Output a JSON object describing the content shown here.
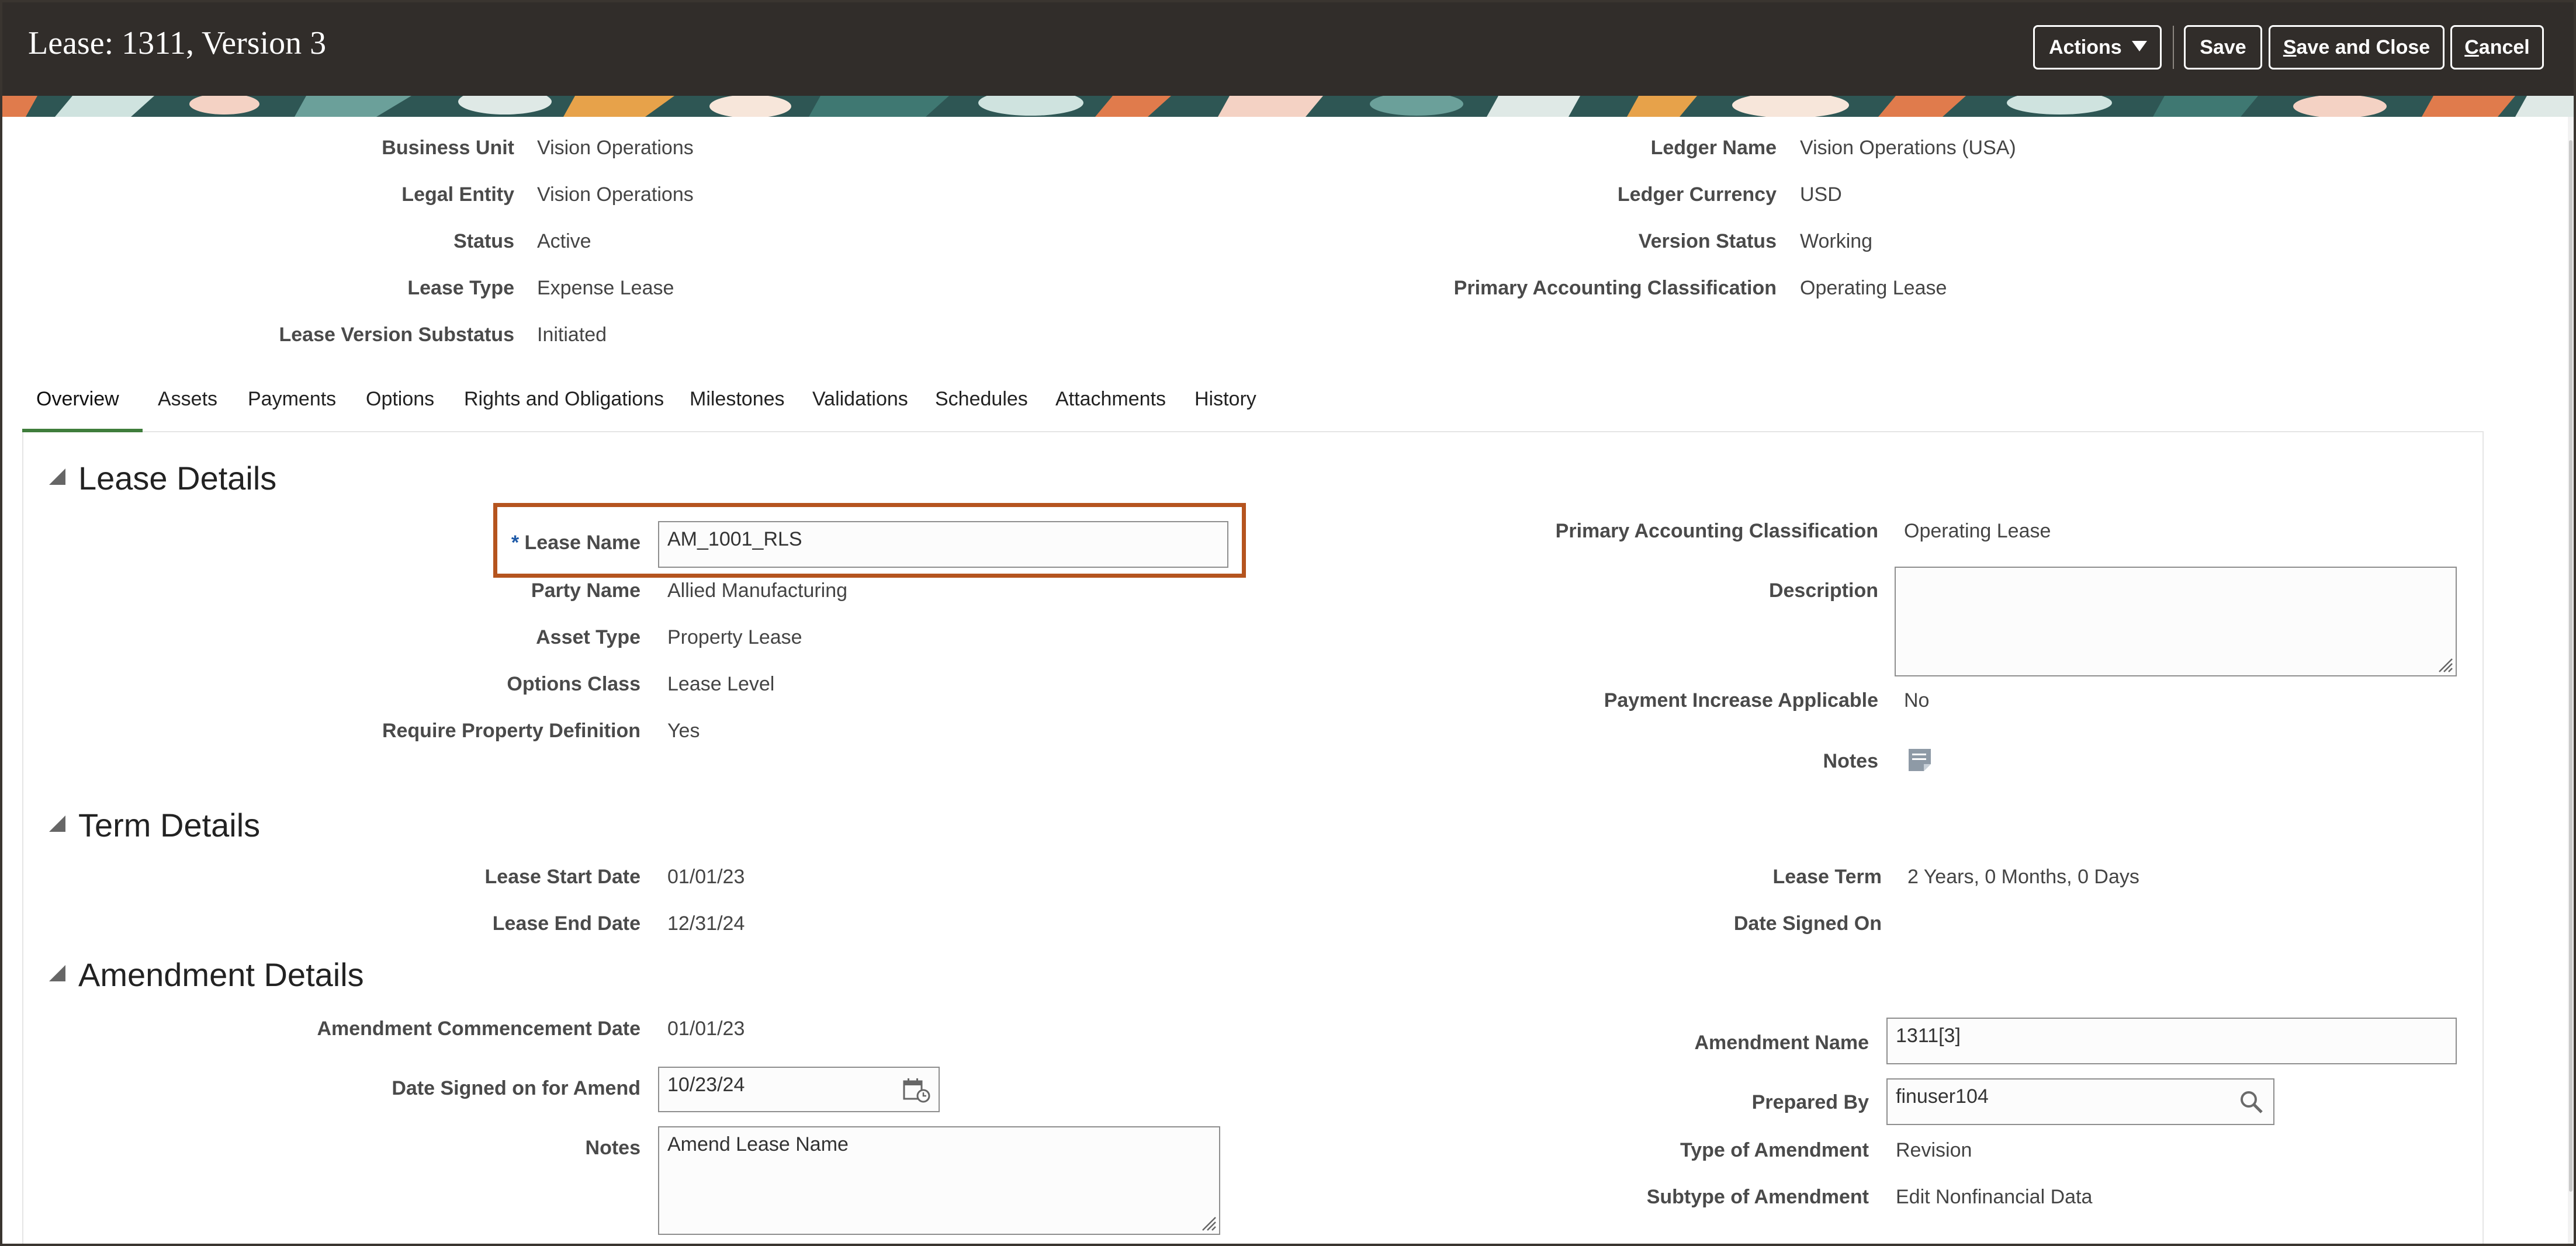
{
  "header": {
    "title": "Lease: 1311, Version 3",
    "actions_label": "Actions",
    "save_label": "Save",
    "save_close_label": "Save and Close",
    "cancel_label": "Cancel"
  },
  "summary": {
    "business_unit": {
      "label": "Business Unit",
      "value": "Vision Operations"
    },
    "legal_entity": {
      "label": "Legal Entity",
      "value": "Vision Operations"
    },
    "status": {
      "label": "Status",
      "value": "Active"
    },
    "lease_type": {
      "label": "Lease Type",
      "value": "Expense Lease"
    },
    "lease_version_substatus": {
      "label": "Lease Version Substatus",
      "value": "Initiated"
    },
    "ledger_name": {
      "label": "Ledger Name",
      "value": "Vision Operations (USA)"
    },
    "ledger_currency": {
      "label": "Ledger Currency",
      "value": "USD"
    },
    "version_status": {
      "label": "Version Status",
      "value": "Working"
    },
    "primary_accounting_classification": {
      "label": "Primary Accounting Classification",
      "value": "Operating Lease"
    }
  },
  "tabs": [
    "Overview",
    "Assets",
    "Payments",
    "Options",
    "Rights and Obligations",
    "Milestones",
    "Validations",
    "Schedules",
    "Attachments",
    "History"
  ],
  "active_tab": "Overview",
  "lease_details": {
    "title": "Lease Details",
    "required_mark": "*",
    "lease_name": {
      "label": "Lease Name",
      "value": "AM_1001_RLS"
    },
    "party_name": {
      "label": "Party Name",
      "value": "Allied Manufacturing"
    },
    "asset_type": {
      "label": "Asset Type",
      "value": "Property Lease"
    },
    "options_class": {
      "label": "Options Class",
      "value": "Lease Level"
    },
    "require_property_definition": {
      "label": "Require Property Definition",
      "value": "Yes"
    },
    "primary_accounting_classification": {
      "label": "Primary Accounting Classification",
      "value": "Operating Lease"
    },
    "description": {
      "label": "Description",
      "value": ""
    },
    "payment_increase_applicable": {
      "label": "Payment Increase Applicable",
      "value": "No"
    },
    "notes": {
      "label": "Notes"
    }
  },
  "term_details": {
    "title": "Term Details",
    "lease_start_date": {
      "label": "Lease Start Date",
      "value": "01/01/23"
    },
    "lease_end_date": {
      "label": "Lease End Date",
      "value": "12/31/24"
    },
    "lease_term": {
      "label": "Lease Term",
      "value": "2 Years, 0 Months, 0 Days"
    },
    "date_signed_on": {
      "label": "Date Signed On",
      "value": ""
    }
  },
  "amendment_details": {
    "title": "Amendment Details",
    "commencement_date": {
      "label": "Amendment Commencement Date",
      "value": "01/01/23"
    },
    "date_signed_on_for_amend": {
      "label": "Date Signed on for Amend",
      "value": "10/23/24"
    },
    "notes": {
      "label": "Notes",
      "value": "Amend Lease Name"
    },
    "amendment_name": {
      "label": "Amendment Name",
      "value": "1311[3]"
    },
    "prepared_by": {
      "label": "Prepared By",
      "value": "finuser104"
    },
    "type_of_amendment": {
      "label": "Type of Amendment",
      "value": "Revision"
    },
    "subtype_of_amendment": {
      "label": "Subtype of Amendment",
      "value": "Edit Nonfinancial Data"
    }
  },
  "colors": {
    "header_bg": "#312d2a",
    "highlight_border": "#b5541e",
    "active_tab_underline": "#3f7d3c",
    "required_asterisk": "#1e5aa8"
  }
}
